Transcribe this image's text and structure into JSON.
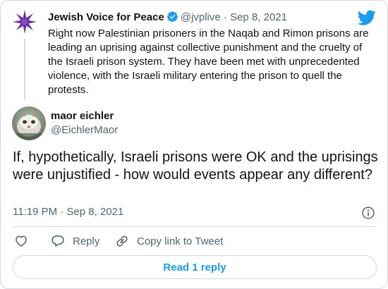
{
  "parent_tweet": {
    "name": "Jewish Voice for Peace",
    "handle": "@jvplive",
    "separator": "·",
    "date": "Sep 8, 2021",
    "text": "Right now Palestinian prisoners in the Naqab and Rimon prisons are leading an uprising against collective punishment and the cruelty of the Israeli prison system. They have been met with unprecedented violence, with the Israeli military entering the prison to quell the protests.",
    "avatar_icon": "purple-star-logo",
    "verified_icon": "verified-badge-icon"
  },
  "reply_tweet": {
    "name": "maor eichler",
    "handle": "@EichlerMaor",
    "text": "If, hypothetically, Israeli prisons were OK and the uprisings were unjustified - how would events appear any different?",
    "timestamp": "11:19 PM · Sep 8, 2021"
  },
  "actions": {
    "like_icon": "heart-icon",
    "reply_label": "Reply",
    "copy_label": "Copy link to Tweet"
  },
  "read_replies_label": "Read 1 reply",
  "colors": {
    "accent": "#1d9bf0",
    "secondary_text": "#536471",
    "border": "#cfd9de",
    "brand_purple": "#6b2fa3"
  }
}
